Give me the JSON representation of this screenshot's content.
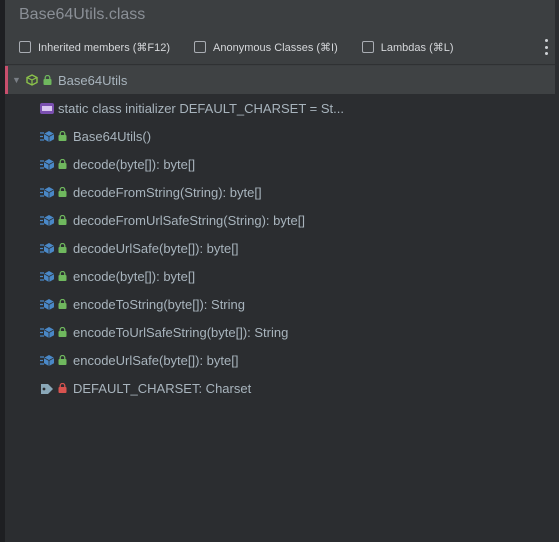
{
  "window": {
    "title": "Base64Utils.class"
  },
  "filters": [
    {
      "label": "Inherited members (⌘F12)",
      "checked": false
    },
    {
      "label": "Anonymous Classes (⌘I)",
      "checked": false
    },
    {
      "label": "Lambdas (⌘L)",
      "checked": false
    }
  ],
  "tree": {
    "root": {
      "label": "Base64Utils",
      "icon": "class-icon",
      "expanded": true
    },
    "items": [
      {
        "label": "static class initializer  DEFAULT_CHARSET = St...",
        "icon": "static-initializer-icon",
        "lock_color": ""
      },
      {
        "label": "Base64Utils()",
        "icon": "method-icon",
        "lock_color": "#6fb85e"
      },
      {
        "label": "decode(byte[]): byte[]",
        "icon": "method-icon",
        "lock_color": "#6fb85e"
      },
      {
        "label": "decodeFromString(String): byte[]",
        "icon": "method-icon",
        "lock_color": "#6fb85e"
      },
      {
        "label": "decodeFromUrlSafeString(String): byte[]",
        "icon": "method-icon",
        "lock_color": "#6fb85e"
      },
      {
        "label": "decodeUrlSafe(byte[]): byte[]",
        "icon": "method-icon",
        "lock_color": "#6fb85e"
      },
      {
        "label": "encode(byte[]): byte[]",
        "icon": "method-icon",
        "lock_color": "#6fb85e"
      },
      {
        "label": "encodeToString(byte[]): String",
        "icon": "method-icon",
        "lock_color": "#6fb85e"
      },
      {
        "label": "encodeToUrlSafeString(byte[]): String",
        "icon": "method-icon",
        "lock_color": "#6fb85e"
      },
      {
        "label": "encodeUrlSafe(byte[]): byte[]",
        "icon": "method-icon",
        "lock_color": "#6fb85e"
      },
      {
        "label": "DEFAULT_CHARSET: Charset",
        "icon": "field-icon",
        "lock_color": "#d9534f"
      }
    ]
  },
  "colors": {
    "accent_lock_green": "#6fb85e",
    "accent_lock_red": "#d9534f",
    "method_icon_blue": "#4a88c7",
    "selection_marker": "#c94f6d"
  }
}
